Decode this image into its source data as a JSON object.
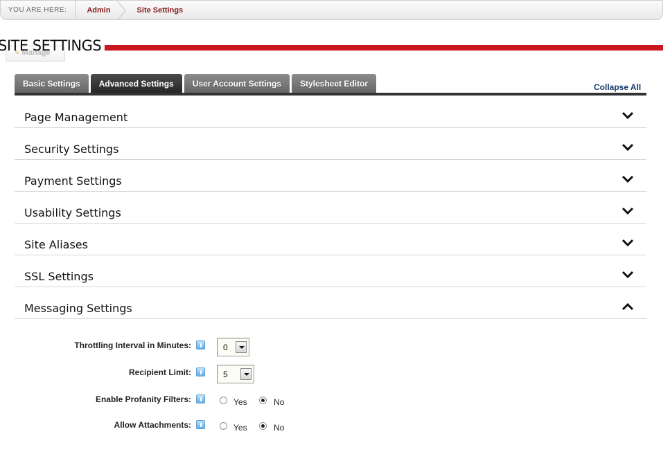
{
  "breadcrumb": {
    "here_label": "YOU ARE HERE:",
    "items": [
      "Admin",
      "Site Settings"
    ]
  },
  "page": {
    "title": "SITE SETTINGS",
    "manage_label": "Manage"
  },
  "tabs": [
    {
      "label": "Basic Settings",
      "active": false
    },
    {
      "label": "Advanced Settings",
      "active": true
    },
    {
      "label": "User Account Settings",
      "active": false
    },
    {
      "label": "Stylesheet Editor",
      "active": false
    }
  ],
  "collapse_all_label": "Collapse All",
  "sections": [
    {
      "title": "Page Management",
      "expanded": false
    },
    {
      "title": "Security Settings",
      "expanded": false
    },
    {
      "title": "Payment Settings",
      "expanded": false
    },
    {
      "title": "Usability Settings",
      "expanded": false
    },
    {
      "title": "Site Aliases",
      "expanded": false
    },
    {
      "title": "SSL Settings",
      "expanded": false
    },
    {
      "title": "Messaging Settings",
      "expanded": true
    }
  ],
  "messaging": {
    "throttling": {
      "label": "Throttling Interval in Minutes:",
      "value": "0"
    },
    "recipient_limit": {
      "label": "Recipient Limit:",
      "value": "5"
    },
    "profanity": {
      "label": "Enable Profanity Filters:",
      "yes": "Yes",
      "no": "No",
      "selected": "No"
    },
    "attachments": {
      "label": "Allow Attachments:",
      "yes": "Yes",
      "no": "No",
      "selected": "No"
    }
  },
  "colors": {
    "accent_red": "#c8171e",
    "link_red": "#8b1a1a",
    "link_blue": "#163a6b"
  }
}
